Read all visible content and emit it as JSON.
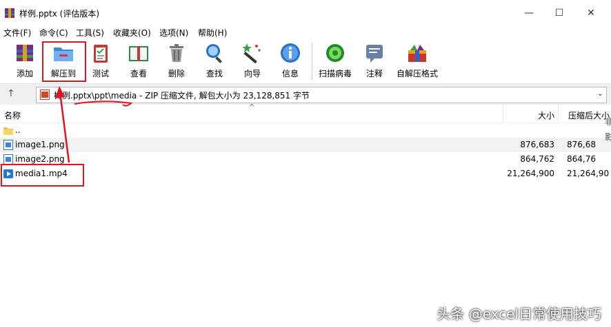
{
  "window": {
    "title": "样例.pptx (评估版本)"
  },
  "menu": [
    "文件(F)",
    "命令(C)",
    "工具(S)",
    "收藏夹(O)",
    "选项(N)",
    "帮助(H)"
  ],
  "toolbar": [
    {
      "label": "添加",
      "icon": "add-archive-icon"
    },
    {
      "label": "解压到",
      "icon": "extract-to-icon"
    },
    {
      "label": "测试",
      "icon": "test-icon"
    },
    {
      "label": "查看",
      "icon": "view-icon"
    },
    {
      "label": "删除",
      "icon": "delete-icon"
    },
    {
      "label": "查找",
      "icon": "find-icon"
    },
    {
      "label": "向导",
      "icon": "wizard-icon"
    },
    {
      "label": "信息",
      "icon": "info-icon"
    },
    {
      "label": "扫描病毒",
      "icon": "virus-scan-icon"
    },
    {
      "label": "注释",
      "icon": "comment-icon"
    },
    {
      "label": "自解压格式",
      "icon": "sfx-icon"
    }
  ],
  "address": {
    "text": "样例.pptx\\ppt\\media - ZIP 压缩文件, 解包大小为 23,128,851 字节"
  },
  "columns": {
    "name": "名称",
    "size": "大小",
    "packed": "压缩后大小"
  },
  "files": [
    {
      "name": "..",
      "size": "",
      "packed": "",
      "icon": "folder-up-icon"
    },
    {
      "name": "image1.png",
      "size": "876,683",
      "packed": "876,68",
      "icon": "image-file-icon"
    },
    {
      "name": "image2.png",
      "size": "864,762",
      "packed": "864,76",
      "icon": "image-file-icon"
    },
    {
      "name": "media1.mp4",
      "size": "21,264,900",
      "packed": "21,264,90",
      "icon": "video-file-icon"
    }
  ],
  "right_edge_chars": [
    "非",
    "影"
  ],
  "watermark": "头条 @excel日常使用技巧",
  "colors": {
    "annotation": "#e0141e",
    "selected_row": "#f2f2f2"
  }
}
